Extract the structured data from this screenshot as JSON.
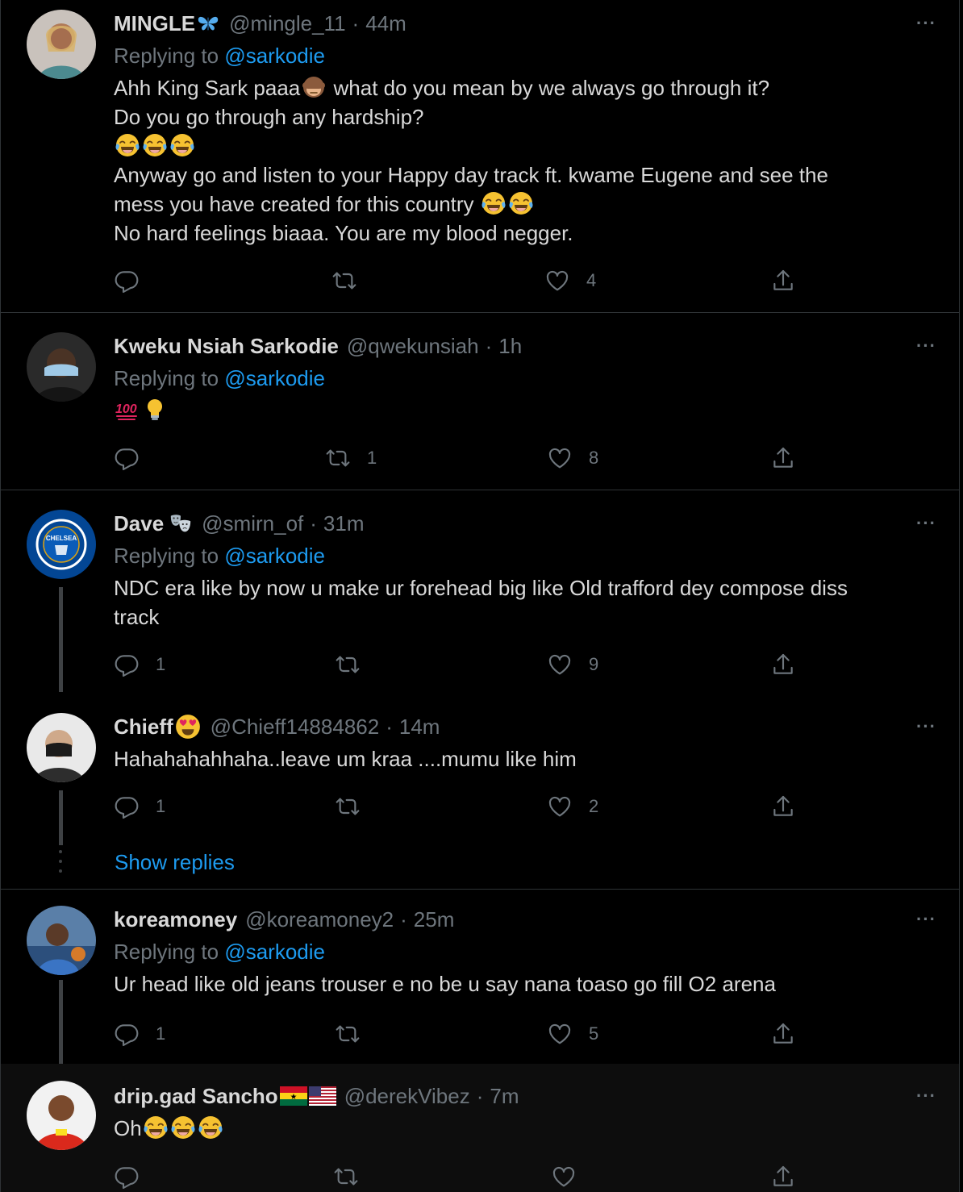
{
  "tweets": [
    {
      "name": "MINGLE",
      "handle": "@mingle_11",
      "time": "44m",
      "replying_label": "Replying to",
      "replying_to": "@sarkodie",
      "body_lines": [
        "Ahh King Sark paaa",
        "what do you mean by we always go through it?",
        "Do you go through any hardship?",
        "Anyway go and listen to your Happy day track ft. kwame Eugene and see the",
        "mess you have created for this country",
        "No hard feelings biaaa. You are my blood negger."
      ],
      "likes": "4",
      "replies": "",
      "retweets": ""
    },
    {
      "name": "Kweku Nsiah Sarkodie",
      "handle": "@qwekunsiah",
      "time": "1h",
      "replying_label": "Replying to",
      "replying_to": "@sarkodie",
      "replies": "",
      "retweets": "1",
      "likes": "8"
    },
    {
      "name": "Dave",
      "handle": "@smirn_of",
      "time": "31m",
      "replying_label": "Replying to",
      "replying_to": "@sarkodie",
      "body_lines": [
        "NDC era like by now u make ur forehead big like Old trafford dey compose diss",
        "track"
      ],
      "replies": "1",
      "retweets": "",
      "likes": "9"
    },
    {
      "name": "Chieff",
      "handle": "@Chieff14884862",
      "time": "14m",
      "body_lines": [
        "Hahahahahhaha..leave um kraa ....mumu like him"
      ],
      "replies": "1",
      "retweets": "",
      "likes": "2"
    },
    {
      "name": "koreamoney",
      "handle": "@koreamoney2",
      "time": "25m",
      "replying_label": "Replying to",
      "replying_to": "@sarkodie",
      "body_lines": [
        "Ur head like old jeans trouser e no be u say nana toaso go fill O2 arena"
      ],
      "replies": "1",
      "retweets": "",
      "likes": "5"
    },
    {
      "name": "drip.gad Sancho",
      "handle": "@derekVibez",
      "time": "7m",
      "body_lines": [
        "Oh"
      ],
      "replies": "",
      "retweets": "",
      "likes": ""
    }
  ],
  "show_replies": "Show replies",
  "more_icon": "···",
  "time_separator": "·",
  "colors": {
    "background": "#000000",
    "text": "#d9d9d9",
    "muted": "#6e767d",
    "link": "#1d9bf0",
    "border": "#2f3336"
  },
  "icons": {
    "reply": "reply-icon",
    "retweet": "retweet-icon",
    "like": "heart-icon",
    "share": "share-icon",
    "more": "more-icon"
  }
}
